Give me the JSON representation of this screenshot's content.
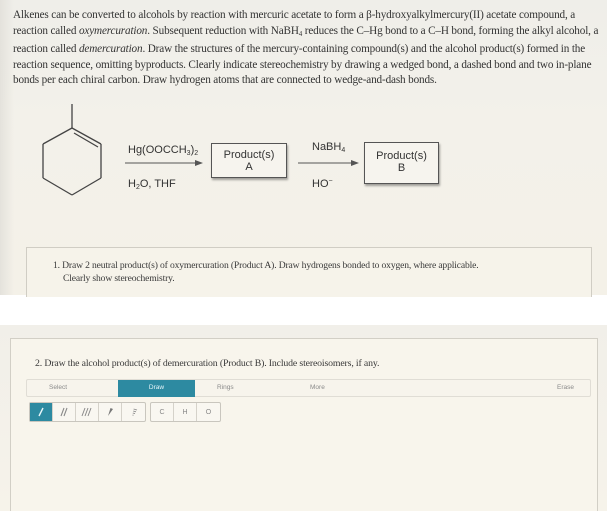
{
  "intro": {
    "part1": "Alkenes can be converted to alcohols by reaction with mercuric acetate to form a β-hydroxyalkylmercury(II) acetate compound, a reaction called ",
    "term1": "oxymercuration",
    "part2": ". Subsequent reduction with NaBH",
    "sub4": "4",
    "part3": " reduces the C–Hg bond to a C–H bond, forming the alkyl alcohol, a reaction called ",
    "term2": "demercuration",
    "part4": ". Draw the structures of the mercury-containing compound(s) and the alcohol product(s) formed in the reaction sequence, omitting byproducts. Clearly indicate stereochemistry by drawing a wedged bond, a dashed bond and two in-plane bonds per each chiral carbon. Draw hydrogen atoms that are connected to wedge-and-dash bonds."
  },
  "scheme": {
    "starting_material": "1-methylcyclohexene",
    "step1": {
      "reagent_top": "Hg(OOCCH",
      "reagent_top_sub": "3",
      "reagent_top_close": ")",
      "reagent_top_sub2": "2",
      "reagent_bottom_pre": "H",
      "reagent_bottom_sub": "2",
      "reagent_bottom_post": "O, THF"
    },
    "product_a": {
      "line1": "Product(s)",
      "line2": "A"
    },
    "step2": {
      "reagent_top": "NaBH",
      "reagent_top_sub": "4",
      "reagent_bottom": "HO",
      "reagent_bottom_sup": "−"
    },
    "product_b": {
      "line1": "Product(s)",
      "line2": "B"
    }
  },
  "question1": {
    "line1": "1. Draw 2 neutral product(s) of oxymercuration (Product A). Draw hydrogens bonded to oxygen, where applicable.",
    "line2": "Clearly show stereochemistry."
  },
  "question2": {
    "text": "2. Draw the alcohol product(s) of demercuration (Product B). Include stereoisomers, if any."
  },
  "toolbar": {
    "tabs": [
      {
        "label": "Select",
        "active": false
      },
      {
        "label": "Draw",
        "active": true
      },
      {
        "label": "Rings",
        "active": false
      },
      {
        "label": "More",
        "active": false
      },
      {
        "label": "Erase",
        "active": false
      }
    ],
    "bond_tools": [
      {
        "icon": "single-bond-icon",
        "active": true
      },
      {
        "icon": "double-bond-icon",
        "active": false
      },
      {
        "icon": "triple-bond-icon",
        "active": false
      },
      {
        "icon": "wedge-bond-icon",
        "active": false
      },
      {
        "icon": "dash-bond-icon",
        "active": false
      }
    ],
    "atoms": [
      "C",
      "H",
      "O"
    ]
  },
  "colors": {
    "accent": "#2d8aa1",
    "page_bg": "#f4f1e8"
  }
}
